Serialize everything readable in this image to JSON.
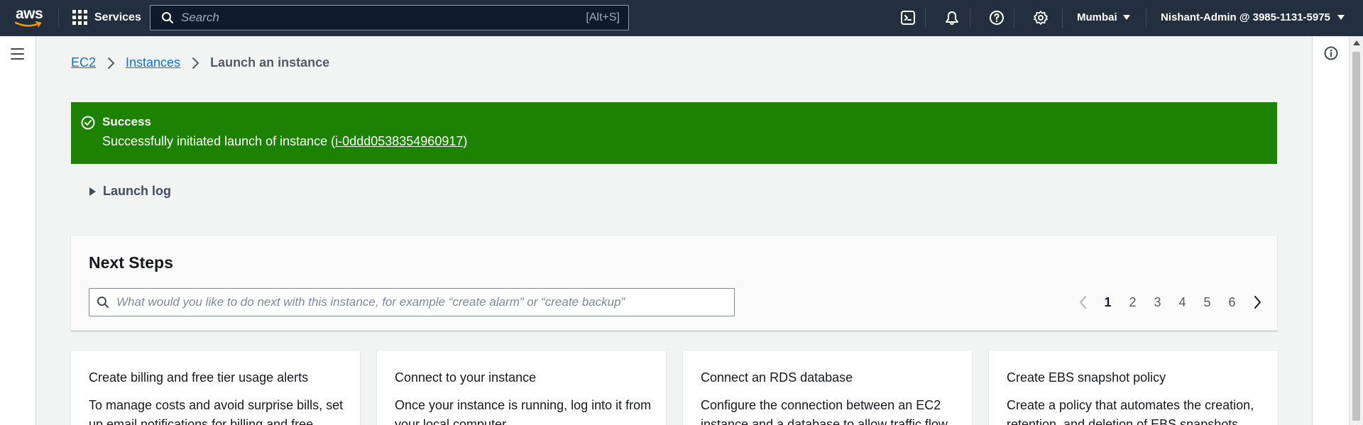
{
  "topnav": {
    "logo_text": "aws",
    "services_label": "Services",
    "search_placeholder": "Search",
    "search_shortcut": "[Alt+S]",
    "region": "Mumbai",
    "account": "Nishant-Admin @ 3985-1131-5975",
    "icons": [
      "cloudshell-icon",
      "notifications-icon",
      "help-icon",
      "settings-icon"
    ]
  },
  "breadcrumb": {
    "items": [
      "EC2",
      "Instances"
    ],
    "current": "Launch an instance"
  },
  "flash": {
    "type": "success",
    "color": "#1d8102",
    "title": "Success",
    "message_prefix": "Successfully initiated launch of instance (",
    "instance_id": "i-0ddd0538354960917",
    "message_suffix": ")"
  },
  "launch_log": {
    "label": "Launch log"
  },
  "next_steps": {
    "title": "Next Steps",
    "search_placeholder": "What would you like to do next with this instance, for example “create alarm” or “create backup”",
    "pages": [
      "1",
      "2",
      "3",
      "4",
      "5",
      "6"
    ],
    "current_page": "1",
    "cards": [
      {
        "title": "Create billing and free tier usage alerts",
        "description": "To manage costs and avoid surprise bills, set up email notifications for billing and free"
      },
      {
        "title": "Connect to your instance",
        "description": "Once your instance is running, log into it from your local computer."
      },
      {
        "title": "Connect an RDS database",
        "description": "Configure the connection between an EC2 instance and a database to allow traffic flow"
      },
      {
        "title": "Create EBS snapshot policy",
        "description": "Create a policy that automates the creation, retention, and deletion of EBS snapshots"
      }
    ]
  }
}
